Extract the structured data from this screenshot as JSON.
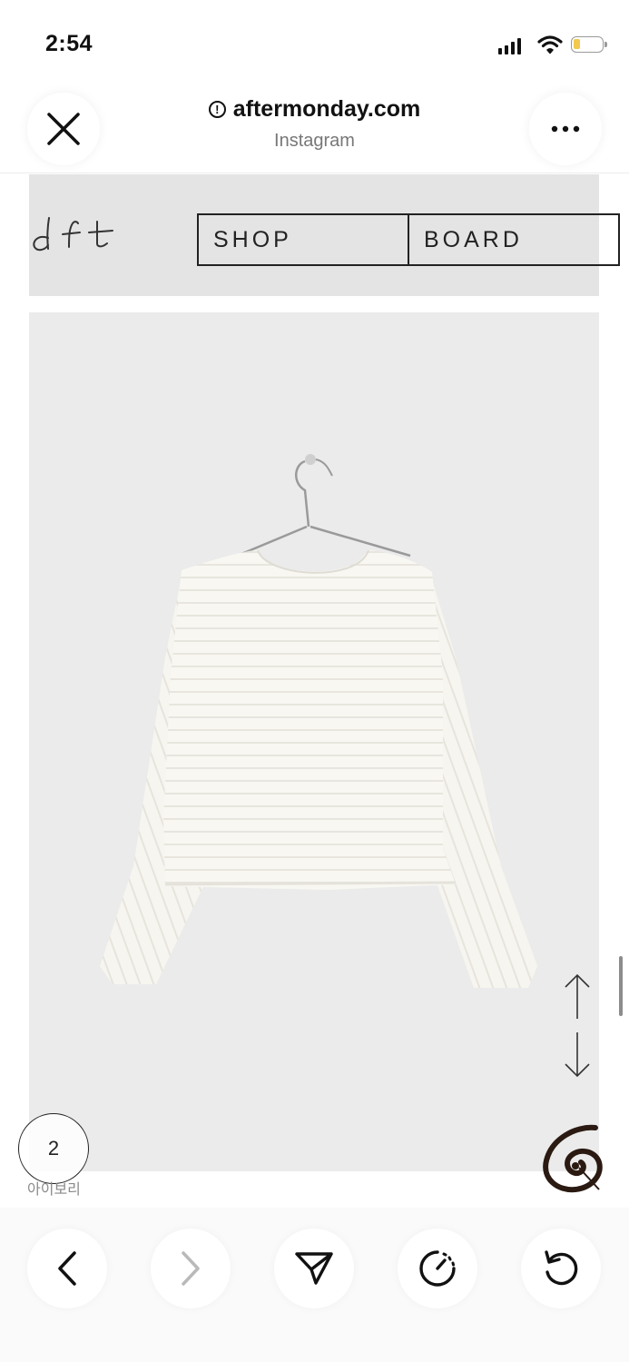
{
  "status_bar": {
    "time": "2:54"
  },
  "browser": {
    "url": "aftermonday.com",
    "source": "Instagram",
    "info_glyph": "!"
  },
  "site": {
    "logo_icon": "aft-handwritten-logo",
    "nav": [
      {
        "label": "SHOP"
      },
      {
        "label": "BOARD"
      }
    ]
  },
  "product": {
    "image_icon": "white-ribbed-top-on-hanger",
    "color_count": "2",
    "color_name": "아이보리"
  },
  "colors": {
    "accent_battery": "#f2c94c",
    "header_bg": "#e4e4e4",
    "image_bg": "#ebebeb"
  },
  "toolbar": {
    "icons": [
      "chevron-left-icon",
      "chevron-right-icon",
      "share-send-icon",
      "speed-gauge-icon",
      "reload-icon"
    ]
  }
}
